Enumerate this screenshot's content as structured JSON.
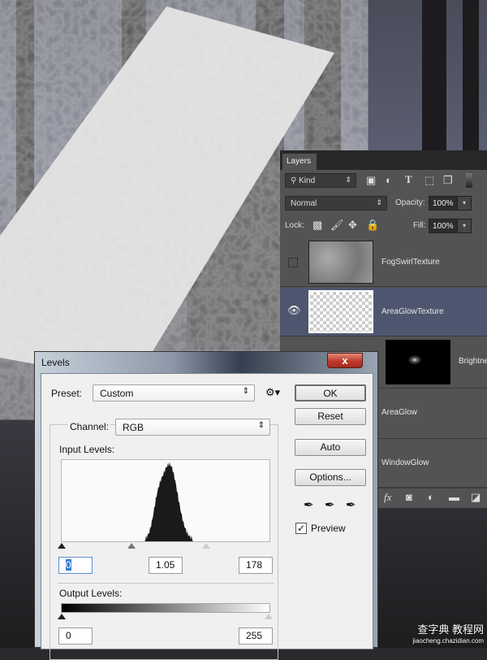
{
  "layers_panel": {
    "tab": "Layers",
    "filter": "Kind",
    "blend_mode": "Normal",
    "opacity_label": "Opacity:",
    "opacity": "100%",
    "lock_label": "Lock:",
    "fill_label": "Fill:",
    "fill": "100%",
    "layers": [
      {
        "name": "FogSwirlTexture",
        "visible": false
      },
      {
        "name": "AreaGlowTexture",
        "visible": true,
        "selected": true
      },
      {
        "name": "Brightne"
      },
      {
        "name": "AreaGlow"
      },
      {
        "name": "WindowGlow"
      }
    ],
    "footer_fx": "fx"
  },
  "levels_dialog": {
    "title": "Levels",
    "close": "x",
    "preset_label": "Preset:",
    "preset": "Custom",
    "channel_label": "Channel:",
    "channel": "RGB",
    "input_levels_label": "Input Levels:",
    "input_black": "0",
    "input_gamma": "1.05",
    "input_white": "178",
    "output_levels_label": "Output Levels:",
    "output_black": "0",
    "output_white": "255",
    "buttons": {
      "ok": "OK",
      "reset": "Reset",
      "auto": "Auto",
      "options": "Options..."
    },
    "preview_label": "Preview",
    "preview_checked": true
  },
  "watermark": {
    "line1": "查字典 教程网",
    "line2": "jiaocheng.chazidian.com"
  }
}
